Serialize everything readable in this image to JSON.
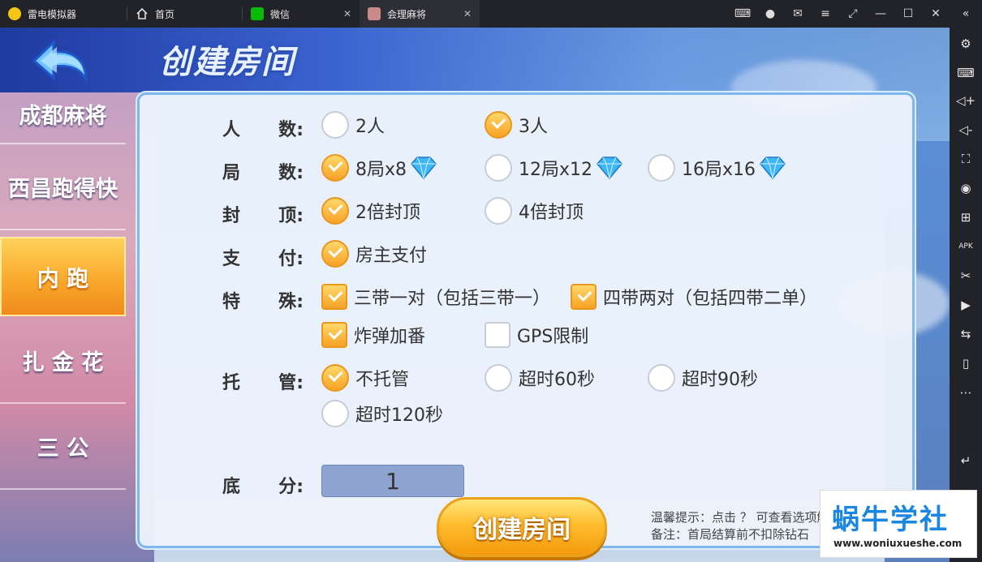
{
  "tabs": [
    {
      "label": "雷电模拟器",
      "icon": "ldplayer-logo-icon"
    },
    {
      "label": "首页",
      "icon": "home-icon"
    },
    {
      "label": "微信",
      "icon": "wechat-icon"
    },
    {
      "label": "会理麻将",
      "icon": "game-app-icon",
      "active": true
    }
  ],
  "header": {
    "title": "创建房间"
  },
  "menu": {
    "items": [
      {
        "label": "成都麻将"
      },
      {
        "label": "西昌跑得快"
      },
      {
        "label": "内 跑",
        "selected": true
      },
      {
        "label": "扎 金 花"
      },
      {
        "label": "三 公"
      }
    ]
  },
  "form": {
    "players": {
      "label_a": "人",
      "label_b": "数",
      "options": [
        "2人",
        "3人"
      ],
      "selected": "3人"
    },
    "rounds": {
      "label_a": "局",
      "label_b": "数",
      "options": [
        "8局x8",
        "12局x12",
        "16局x16"
      ],
      "selected": "8局x8"
    },
    "cap": {
      "label_a": "封",
      "label_b": "顶",
      "options": [
        "2倍封顶",
        "4倍封顶"
      ],
      "selected": "2倍封顶"
    },
    "pay": {
      "label_a": "支",
      "label_b": "付",
      "options": [
        "房主支付"
      ],
      "selected": "房主支付"
    },
    "special": {
      "label_a": "特",
      "label_b": "殊",
      "options": [
        "三带一对（包括三带一）",
        "四带两对（包括四带二单）",
        "炸弹加番",
        "GPS限制"
      ],
      "checked": [
        "三带一对（包括三带一）",
        "四带两对（包括四带二单）",
        "炸弹加番"
      ]
    },
    "trustee": {
      "label_a": "托",
      "label_b": "管",
      "options": [
        "不托管",
        "超时60秒",
        "超时90秒",
        "超时120秒"
      ],
      "selected": "不托管"
    },
    "base_score": {
      "label_a": "底",
      "label_b": "分",
      "value": "1"
    }
  },
  "create_button": "创建房间",
  "tips": {
    "line1": "温馨提示：点击 ？ 可查看选项解释",
    "line2": "备注：首局结算前不扣除钻石"
  },
  "watermark": {
    "logo": "蜗牛学社",
    "url": "www.woniuxueshe.com"
  },
  "colors": {
    "accent_orange": "#f8a225",
    "panel_bg": "#ecf2fc",
    "header_blue": "#3b63d0"
  }
}
